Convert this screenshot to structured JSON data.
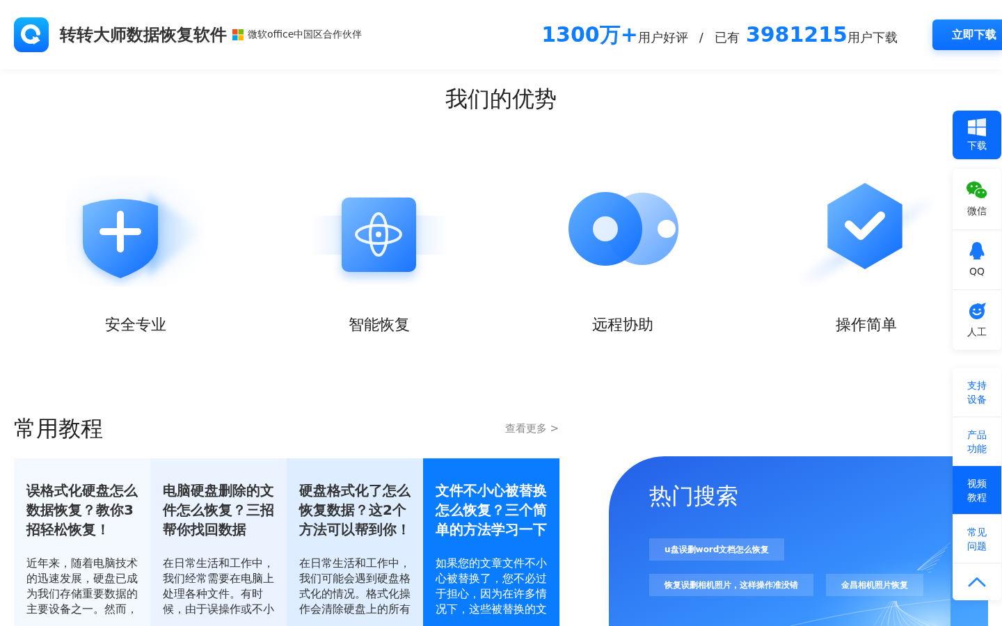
{
  "header": {
    "site_title": "转转大师数据恢复软件",
    "partner_text": "微软office中国区合作伙伴",
    "stats": {
      "rating_count": "1300万+",
      "rating_label": "用户好评",
      "separator": "/",
      "downloads_prefix": "已有",
      "downloads_count": "3981215",
      "downloads_label": "用户下载"
    },
    "download_button": "立即下载"
  },
  "advantages": {
    "title": "我们的优势",
    "items": [
      {
        "kind": "shield",
        "label": "安全专业"
      },
      {
        "kind": "atom",
        "label": "智能恢复"
      },
      {
        "kind": "circles",
        "label": "远程协助"
      },
      {
        "kind": "hexagon",
        "label": "操作简单"
      }
    ]
  },
  "tutorials": {
    "title": "常用教程",
    "more_link": "查看更多 >",
    "cards": [
      {
        "title": "误格式化硬盘怎么数据恢复？教你3招轻松恢复！",
        "excerpt": "近年来，随着电脑技术的迅速发展，硬盘已成为我们存储重要数据的主要设备之一。然而，",
        "selected": false
      },
      {
        "title": "电脑硬盘删除的文件怎么恢复？三招帮你找回数据",
        "excerpt": "在日常生活和工作中，我们经常需要在电脑上处理各种文件。有时候，由于误操作或不小",
        "selected": false
      },
      {
        "title": "硬盘格式化了怎么恢复数据？这2个方法可以帮到你！",
        "excerpt": "在日常生活和工作中，我们可能会遇到硬盘格式化的情况。格式化操作会清除硬盘上的所有",
        "selected": false
      },
      {
        "title": "文件不小心被替换怎么恢复？三个简单的方法学习一下",
        "excerpt": "如果您的文章文件不小心被替换了，您不必过于担心，因为在许多情况下，这些被替换的文",
        "selected": true
      }
    ]
  },
  "hot_search": {
    "title": "热门搜索",
    "rows": [
      [
        "u盘误删word文档怎么恢复"
      ],
      [
        "恢复误删相机照片，这样操作准没错",
        "金昌相机照片恢复"
      ]
    ]
  },
  "side_toolbar": {
    "download_button": "下载",
    "contacts": [
      {
        "kind": "wechat",
        "label": "微信"
      },
      {
        "kind": "qq",
        "label": "QQ"
      },
      {
        "kind": "agent",
        "label": "人工"
      }
    ],
    "nav": [
      {
        "label": "支持设备",
        "selected": false
      },
      {
        "label": "产品功能",
        "selected": false
      },
      {
        "label": "视频教程",
        "selected": true
      },
      {
        "label": "常见问题",
        "selected": false
      }
    ]
  }
}
